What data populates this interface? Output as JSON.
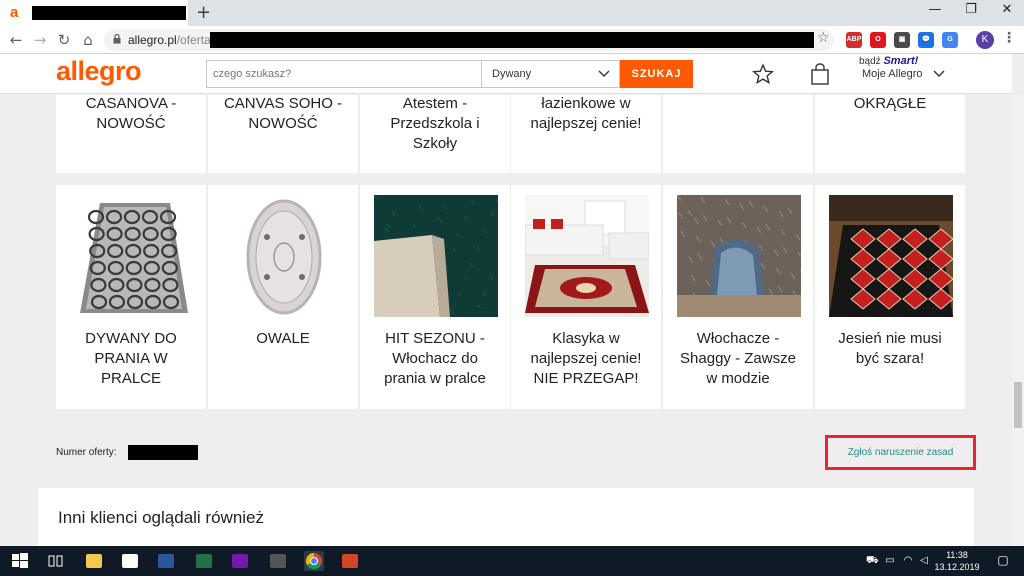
{
  "browser": {
    "tab_favicon": "a",
    "new_tab_label": "+",
    "window_controls": [
      "—",
      "❐",
      "✕"
    ],
    "url_domain": "allegro.pl",
    "url_path": "/oferta/",
    "extensions": [
      {
        "name": "abp-icon",
        "label": "ABP",
        "color": "#d32e2e"
      },
      {
        "name": "opera-icon",
        "label": "O",
        "color": "#e0161f"
      },
      {
        "name": "shield-ext-icon",
        "label": "▣",
        "color": "#4a4a4a"
      },
      {
        "name": "chat-ext-icon",
        "label": "💬",
        "color": "#1a73e8"
      },
      {
        "name": "translate-ext-icon",
        "label": "G",
        "color": "#4285f4"
      }
    ],
    "profile_initial": "K"
  },
  "header": {
    "logo": "allegro",
    "search_placeholder": "czego szukasz?",
    "category": "Dywany",
    "search_button": "SZUKAJ",
    "smart_prefix": "bądź ",
    "smart_word": "Smart!",
    "account_label": "Moje Allegro"
  },
  "top_cards": [
    {
      "title": "CASANOVA -\nNOWOŚĆ"
    },
    {
      "title": "CANVAS SOHO -\nNOWOŚĆ"
    },
    {
      "title": "Atestem -\nPrzedszkola i\nSzkoły"
    },
    {
      "title": "łazienkowe w\nnajlepszej cenie!"
    },
    {
      "title": ""
    },
    {
      "title": "OKRĄGŁE"
    }
  ],
  "cards": [
    {
      "title": "DYWANY DO\nPRANIA W\nPRALCE",
      "image": "grey-lattice-rug"
    },
    {
      "title": "OWALE",
      "image": "oval-rug"
    },
    {
      "title": "HIT SEZONU -\nWłochacz do\nprania w pralce",
      "image": "green-shaggy-rug"
    },
    {
      "title": "Klasyka w\nnajlepszej cenie!\nNIE PRZEGAP!",
      "image": "classic-red-rug-room"
    },
    {
      "title": "Włochacze -\nShaggy - Zawsze\nw modzie",
      "image": "brown-shaggy-rug"
    },
    {
      "title": "Jesień nie musi\nbyć szara!",
      "image": "red-pattern-rug-room"
    }
  ],
  "offer": {
    "label": "Numer oferty:",
    "report_link": "Zgłoś naruszenie zasad"
  },
  "others": {
    "title": "Inni klienci oglądali również"
  },
  "taskbar": {
    "time": "11:38",
    "date": "13.12.2019",
    "apps": [
      {
        "name": "windows-start-icon",
        "color": "#ffffff"
      },
      {
        "name": "task-view-icon",
        "color": "#ffffff"
      },
      {
        "name": "file-explorer-icon",
        "color": "#f2c94c"
      },
      {
        "name": "mail-icon",
        "color": "#ffffff"
      },
      {
        "name": "word-icon",
        "color": "#2b579a"
      },
      {
        "name": "excel-icon",
        "color": "#217346"
      },
      {
        "name": "onenote-icon",
        "color": "#7719aa"
      },
      {
        "name": "calculator-icon",
        "color": "#555555"
      },
      {
        "name": "chrome-icon",
        "color": "#4caf50"
      },
      {
        "name": "powerpoint-icon",
        "color": "#d24726"
      }
    ]
  },
  "colors": {
    "accent": "#ff5a00",
    "report_link": "#2a8a8a",
    "highlight": "#e8262c"
  }
}
